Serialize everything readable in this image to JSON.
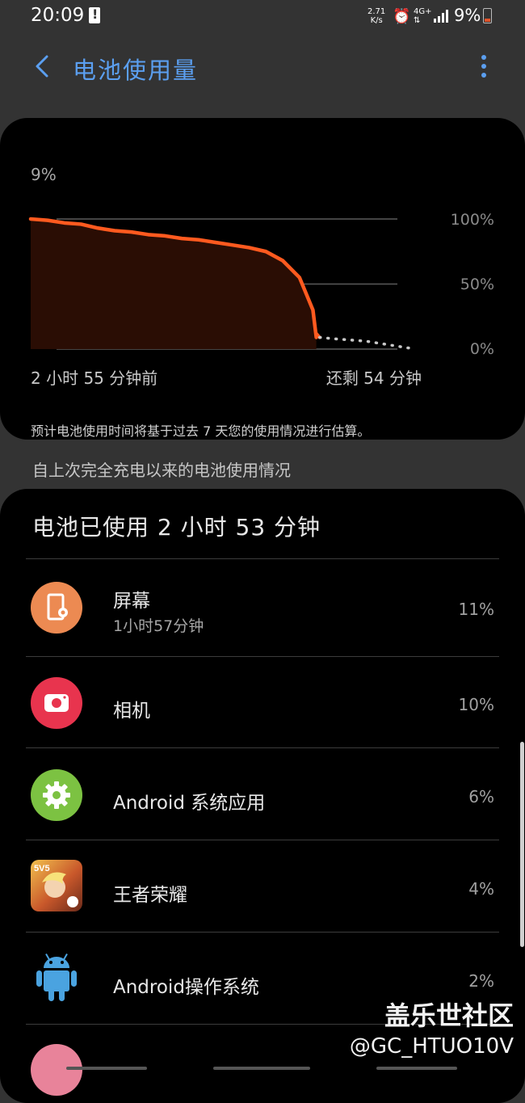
{
  "status": {
    "time": "20:09",
    "speed_top": "2.71",
    "speed_bottom": "K/s",
    "network": "4G+",
    "battery": "9%"
  },
  "header": {
    "title": "电池使用量"
  },
  "chart": {
    "current_level": "9%",
    "note": "预计电池使用时间将基于过去 7 天您的使用情况进行估算。"
  },
  "chart_data": {
    "type": "area",
    "title": "",
    "xlabel": "",
    "ylabel": "",
    "x_start_label": "2 小时 55 分钟前",
    "x_end_label": "还剩 54 分钟",
    "y_ticks": [
      "100%",
      "50%",
      "0%"
    ],
    "ylim": [
      0,
      100
    ],
    "elapsed_minutes": 175,
    "remaining_minutes": 54,
    "series": [
      {
        "points": [
          [
            0,
            100
          ],
          [
            10,
            99
          ],
          [
            20,
            97
          ],
          [
            30,
            96
          ],
          [
            40,
            93
          ],
          [
            50,
            91
          ],
          [
            60,
            90
          ],
          [
            70,
            88
          ],
          [
            80,
            87
          ],
          [
            90,
            85
          ],
          [
            100,
            84
          ],
          [
            110,
            82
          ],
          [
            120,
            80
          ],
          [
            130,
            78
          ],
          [
            140,
            75
          ],
          [
            150,
            68
          ],
          [
            160,
            55
          ],
          [
            168,
            30
          ],
          [
            170,
            9
          ]
        ],
        "color": "#ff5a1f",
        "fill": "#2a0d04"
      }
    ],
    "projection": {
      "points": [
        [
          170,
          12
        ],
        [
          172,
          9
        ],
        [
          180,
          8
        ],
        [
          200,
          6
        ],
        [
          229,
          0
        ]
      ],
      "style": "dotted",
      "color": "#c8c8c8"
    },
    "grid": true
  },
  "section_title": "自上次完全充电以来的电池使用情况",
  "usage": {
    "total": "电池已使用 2 小时 53 分钟",
    "apps": [
      {
        "name": "屏幕",
        "time": "1小时57分钟",
        "percent": "11%",
        "icon": "screen-icon",
        "color": "#ec8a52"
      },
      {
        "name": "相机",
        "time": "",
        "percent": "10%",
        "icon": "camera-icon",
        "color": "#e8344e"
      },
      {
        "name": "Android 系统应用",
        "time": "",
        "percent": "6%",
        "icon": "android-system-gear-icon",
        "color": "#7cc242"
      },
      {
        "name": "王者荣耀",
        "time": "",
        "percent": "4%",
        "icon": "game-icon",
        "color": "#c9582b"
      },
      {
        "name": "Android操作系统",
        "time": "",
        "percent": "2%",
        "icon": "android-robot-icon",
        "color": "#4aa3e0"
      },
      {
        "name": "",
        "time": "",
        "percent": "",
        "icon": "app-icon",
        "color": "#e8839a"
      }
    ]
  },
  "watermark": {
    "line1": "盖乐世社区",
    "line2": "@GC_HTUO10V"
  }
}
